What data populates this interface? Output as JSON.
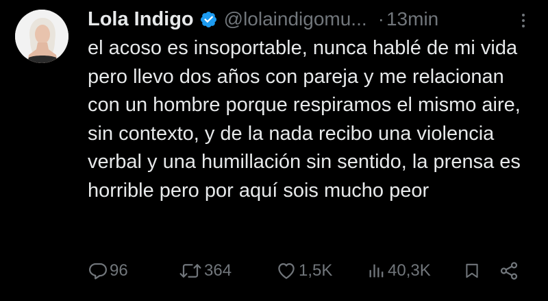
{
  "author": {
    "name": "Lola Indigo",
    "handle": "@lolaindigomu...",
    "separator": "·",
    "time": "13min",
    "verified_color": "#1d9bf0"
  },
  "tweet": {
    "text": "el acoso es insoportable, nunca hablé de mi vida pero llevo dos años con pareja y me relacionan con un hombre porque respiramos el mismo aire, sin contexto, y de la nada recibo una violencia verbal y una humillación sin sentido, la prensa es horrible pero por aquí sois mucho peor"
  },
  "actions": {
    "replies": "96",
    "retweets": "364",
    "likes": "1,5K",
    "views": "40,3K"
  },
  "icons": {
    "reply": "reply-icon",
    "retweet": "retweet-icon",
    "like": "heart-icon",
    "views": "views-icon",
    "bookmark": "bookmark-icon",
    "share": "share-icon",
    "more": "more-options-icon"
  },
  "colors": {
    "background": "#000000",
    "text": "#e7e9ea",
    "muted": "#71767b"
  }
}
